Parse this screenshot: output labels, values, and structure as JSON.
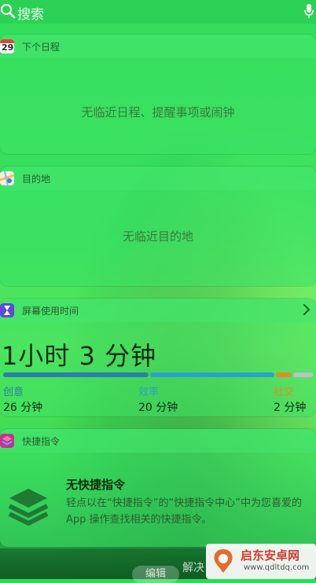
{
  "search": {
    "placeholder": "搜索"
  },
  "widgets": {
    "calendar": {
      "title": "下个日程",
      "icon_day": "29",
      "message": "无临近日程、提醒事项或闹钟"
    },
    "destination": {
      "title": "目的地",
      "message": "无临近目的地"
    },
    "screen_time": {
      "title": "屏幕使用时间",
      "total": "1小时 3 分钟",
      "categories": [
        {
          "label": "创意",
          "value": "26 分钟",
          "color": "#2c7fa8",
          "fraction": 0.47
        },
        {
          "label": "效率",
          "value": "20 分钟",
          "color": "#2aa3c8",
          "fraction": 0.4
        },
        {
          "label": "社交",
          "value": "2 分钟",
          "color": "#e8882c",
          "fraction": 0.05
        }
      ]
    },
    "shortcuts": {
      "title": "快捷指令",
      "heading": "无快捷指令",
      "description": "轻点以在“快捷指令”的“快捷指令中心”中为您喜爱的 App 操作查找相关的快捷指令。"
    }
  },
  "bottom": {
    "edit_label": "编辑",
    "partial_text": "解决"
  },
  "watermark": {
    "main": "启东安卓网",
    "sub": "www.qdltdq.com"
  }
}
